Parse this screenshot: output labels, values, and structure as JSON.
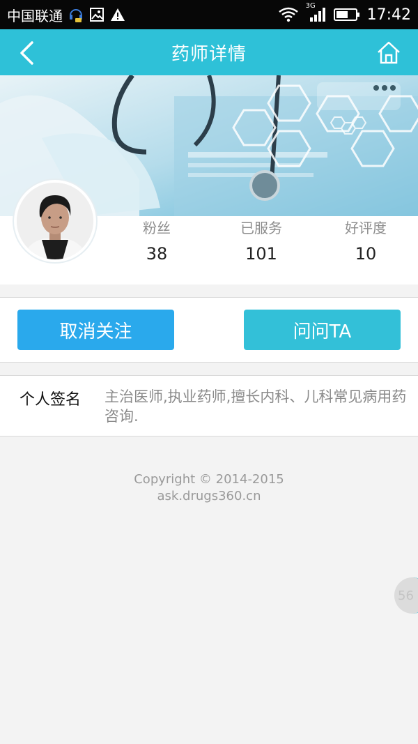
{
  "status_bar": {
    "carrier": "中国联通",
    "network": "3G",
    "time": "17:42"
  },
  "nav": {
    "title": "药师详情",
    "back_icon": "chevron-left-icon",
    "home_icon": "home-icon"
  },
  "stats": [
    {
      "label": "粉丝",
      "value": "38"
    },
    {
      "label": "已服务",
      "value": "101"
    },
    {
      "label": "好评度",
      "value": "10"
    }
  ],
  "actions": {
    "unfollow_label": "取消关注",
    "ask_label": "问问TA"
  },
  "signature": {
    "label": "个人签名",
    "text": "主治医师,执业药师,擅长内科、儿科常见病用药咨询."
  },
  "footer": {
    "copyright": "Copyright © 2014-2015",
    "site": "ask.drugs360.cn"
  },
  "float_badge": {
    "text": "56"
  },
  "colors": {
    "accent": "#2ec1d8",
    "unfollow_button": "#2aa9ec",
    "ask_button": "#33c0d8",
    "status_bar": "#070707",
    "background": "#f3f3f3"
  }
}
